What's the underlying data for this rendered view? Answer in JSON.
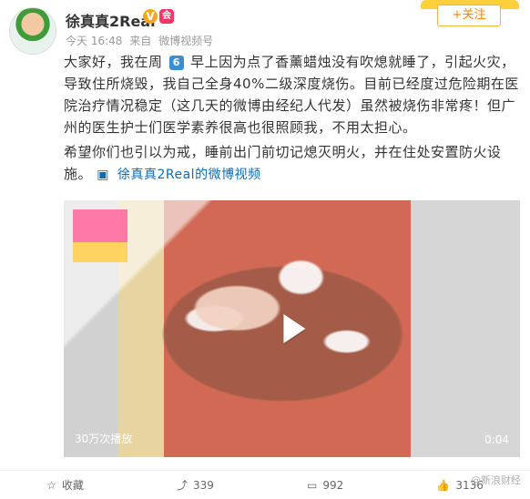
{
  "post": {
    "user": {
      "name": "徐真真2Real"
    },
    "meta": {
      "time": "今天 16:48",
      "source_prefix": "来自",
      "source": "微博视频号"
    },
    "follow_label": "+关注",
    "text": {
      "line1": "大家好，我在周",
      "weekday": "6",
      "line1_cont": "早上因为点了香薰蜡烛没有吹熄就睡了，引起火灾，导致住所烧毁，我自己全身40%二级深度烧伤。目前已经度过危险期在医院治疗情况稳定（这几天的微博由经纪人代发）虽然被烧伤非常疼！但广州的医生护士们医学素养很高也很照顾我，不用太担心。",
      "line2": "希望你们也引以为戒，睡前出门前切记熄灭明火，并在住处安置防火设施。",
      "video_link_text": "徐真真2Real的微博视频"
    },
    "video": {
      "views": "30万次播放",
      "duration": "0:04"
    },
    "actions": {
      "collect": "收藏",
      "share": "339",
      "comment": "992",
      "like": "3136"
    },
    "watermark": "@新浪财经"
  }
}
